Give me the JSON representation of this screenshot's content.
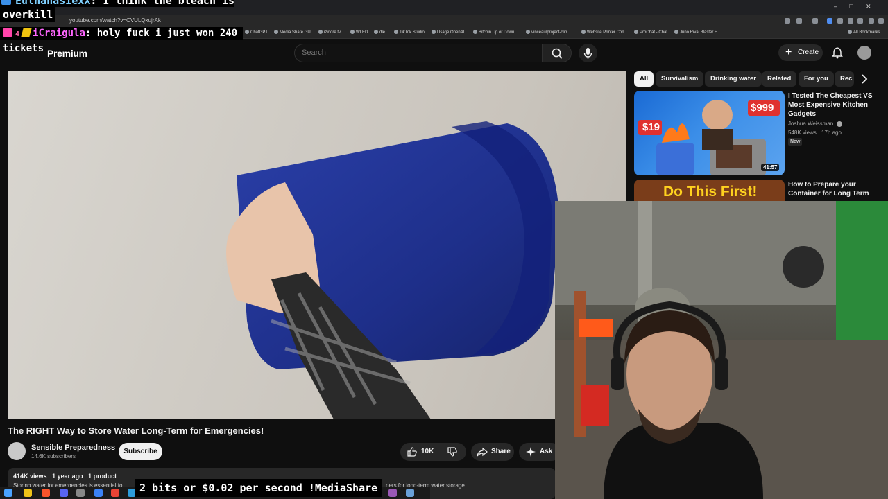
{
  "browser": {
    "url": "youtube.com/watch?v=CVULQxujrAk",
    "bookmarks": [
      "ChatGPT",
      "Media Share GUI",
      "izidore.tv",
      "WLED",
      "dle",
      "TikTok Studio",
      "Usage OpenAI",
      "Bitcoin Up or Down...",
      "vinceau/project-clip...",
      "Website Printer Con...",
      "ProChat - Chat",
      "Juno Rival Blaster H..."
    ],
    "all_bookmarks": "All Bookmarks",
    "window_controls": [
      "–",
      "□",
      "✕"
    ]
  },
  "chat_overlay": {
    "msg1_name": "EuthanasiexX",
    "msg1_text": ": I think the bleach is",
    "msg1_cont": "overkill",
    "msg2_count": "4",
    "msg2_name": "iCraigula",
    "msg2_text": ": holy fuck i just won 240",
    "msg2_cont": "tickets"
  },
  "header": {
    "premium_label": "Premium",
    "search_placeholder": "Search",
    "create_label": "Create"
  },
  "video": {
    "title": "The RIGHT Way to Store Water Long-Term for Emergencies!",
    "channel_name": "Sensible Preparedness",
    "channel_subs": "14.6K subscribers",
    "subscribe_label": "Subscribe",
    "like_count": "10K",
    "share_label": "Share",
    "ask_label": "Ask",
    "views": "414K views",
    "age": "1 year ago",
    "products": "1 product",
    "description_start": "Storing water for emergencies is essential fo",
    "description_end": "ners for long-term water storage"
  },
  "sidebar": {
    "chips": [
      "All",
      "Survivalism",
      "Drinking water",
      "Related",
      "For you",
      "Rec"
    ],
    "rec1": {
      "title": "I Tested The Cheapest VS Most Expensive Kitchen Gadgets",
      "channel": "Joshua Weissman",
      "meta": "548K views · 17h ago",
      "badge": "New",
      "duration": "41:57",
      "thumb_text_left": "$19",
      "thumb_text_right": "$999"
    },
    "rec2": {
      "title": "How to Prepare your Container for Long Term",
      "thumb_text": "Do This First!"
    }
  },
  "overlay_banner": "2 bits or $0.02 per second !MediaShare"
}
